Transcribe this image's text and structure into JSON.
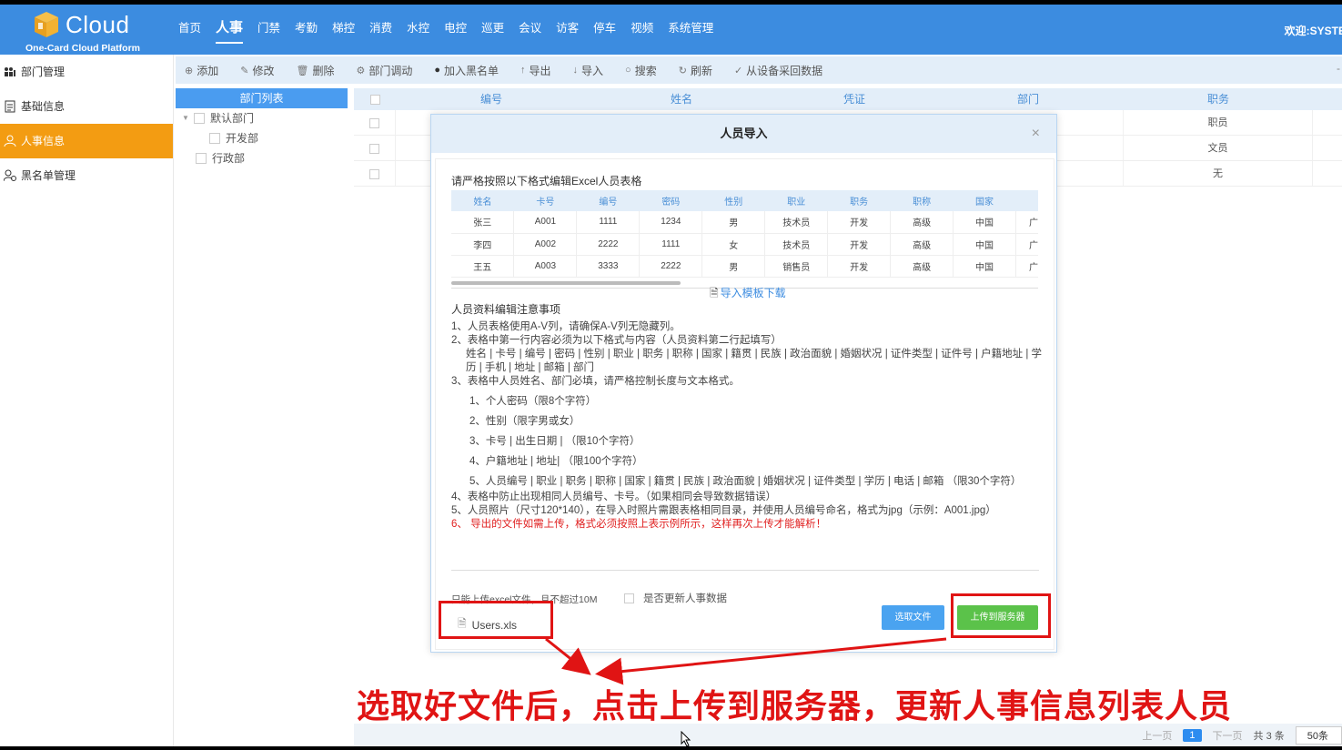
{
  "brand": {
    "name": "Cloud",
    "subtitle": "One-Card Cloud Platform"
  },
  "topnav": {
    "items": [
      "首页",
      "人事",
      "门禁",
      "考勤",
      "梯控",
      "消费",
      "水控",
      "电控",
      "巡更",
      "会议",
      "访客",
      "停车",
      "视频",
      "系统管理"
    ],
    "active": "人事",
    "welcome": "欢迎:SYSTE"
  },
  "sidebar": {
    "items": [
      {
        "label": "部门管理",
        "icon": "org-chart-icon"
      },
      {
        "label": "基础信息",
        "icon": "document-icon"
      },
      {
        "label": "人事信息",
        "icon": "user-icon"
      },
      {
        "label": "黑名单管理",
        "icon": "user-block-icon"
      }
    ],
    "active": "人事信息"
  },
  "toolbar": {
    "add": "添加",
    "edit": "修改",
    "delete": "删除",
    "transfer": "部门调动",
    "blacklist": "加入黑名单",
    "export": "导出",
    "import": "导入",
    "search": "搜索",
    "refresh": "刷新",
    "collect": "从设备采回数据",
    "more": "-"
  },
  "dept": {
    "header": "部门列表",
    "nodes": [
      "默认部门",
      "开发部",
      "行政部"
    ]
  },
  "table": {
    "columns": [
      "编号",
      "姓名",
      "凭证",
      "部门",
      "职务"
    ],
    "rows": [
      {
        "position": "职员"
      },
      {
        "position": "文员"
      },
      {
        "position": "无"
      }
    ]
  },
  "pager": {
    "prev": "上一页",
    "current": "1",
    "next": "下一页",
    "total": "共 3 条",
    "size": "50条"
  },
  "modal": {
    "title": "人员导入",
    "close": "×",
    "intro": "请严格按照以下格式编辑Excel人员表格",
    "sample_columns": [
      "姓名",
      "卡号",
      "编号",
      "密码",
      "性别",
      "职业",
      "职务",
      "职称",
      "国家",
      ""
    ],
    "sample_rows": [
      [
        "张三",
        "A001",
        "1111",
        "1234",
        "男",
        "技术员",
        "开发",
        "高级",
        "中国",
        "广"
      ],
      [
        "李四",
        "A002",
        "2222",
        "1111",
        "女",
        "技术员",
        "开发",
        "高级",
        "中国",
        "广"
      ],
      [
        "王五",
        "A003",
        "3333",
        "2222",
        "男",
        "销售员",
        "开发",
        "高级",
        "中国",
        "广"
      ]
    ],
    "template_link": "导入模板下载",
    "notes_title": "人员资料编辑注意事项",
    "note1": "1、人员表格使用A-V列，请确保A-V列无隐藏列。",
    "note2": "2、表格中第一行内容必须为以下格式与内容（人员资料第二行起填写）",
    "note2_fields": "姓名 | 卡号 | 编号 | 密码 | 性别 | 职业 | 职务 | 职称 | 国家 | 籍贯 | 民族 | 政治面貌 | 婚姻状况 | 证件类型 | 证件号 | 户籍地址 | 学历 | 手机 | 地址 | 邮箱 | 部门",
    "note3": "3、表格中人员姓名、部门必填，请严格控制长度与文本格式。",
    "note3_1": "1、个人密码（限8个字符）",
    "note3_2": "2、性别（限字男或女）",
    "note3_3": "3、卡号 | 出生日期 | （限10个字符）",
    "note3_4": "4、户籍地址 | 地址| （限100个字符）",
    "note3_5": "5、人员编号 | 职业 | 职务 | 职称 | 国家 | 籍贯 | 民族 | 政治面貌 | 婚姻状况 | 证件类型 | 学历 | 电话 | 邮箱 （限30个字符）",
    "note4": "4、表格中防止出现相同人员编号、卡号。（如果相同会导致数据错误）",
    "note5": "5、人员照片（尺寸120*140），在导入时照片需跟表格相同目录，并使用人员编号命名，格式为jpg（示例：A001.jpg）",
    "note6": "6、 导出的文件如需上传，格式必须按照上表示例所示，这样再次上传才能解析！",
    "upload_note": "只能上传excel文件，且不超过10M",
    "update_checkbox": "是否更新人事数据",
    "file_name": "Users.xls",
    "select_button": "选取文件",
    "upload_button": "上传到服务器"
  },
  "annotation": {
    "caption": "选取好文件后，点击上传到服务器，更新人事信息列表人员"
  },
  "colors": {
    "header_blue": "#3c8ce0",
    "sidebar_active": "#f39c12",
    "upload_green": "#5bc24a",
    "select_blue": "#4aa3f0",
    "annotation_red": "#e01414"
  }
}
